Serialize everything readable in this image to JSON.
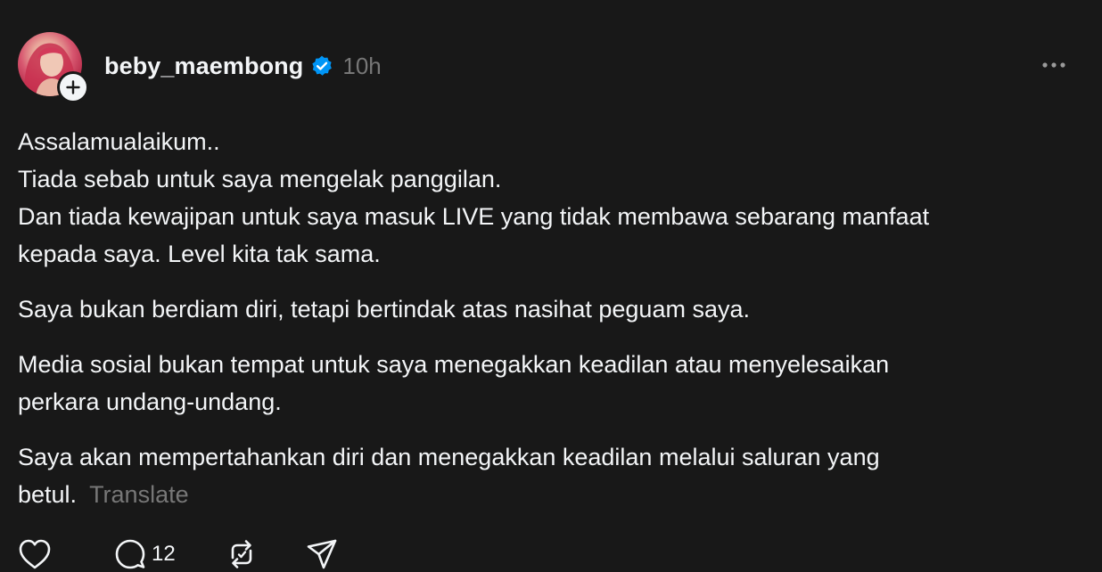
{
  "post": {
    "username": "beby_maembong",
    "timestamp": "10h",
    "verified": true,
    "paragraphs": [
      [
        "Assalamualaikum..",
        "Tiada sebab untuk saya mengelak panggilan.",
        "Dan tiada kewajipan untuk saya masuk LIVE yang tidak membawa sebarang manfaat",
        "kepada saya. Level kita tak sama."
      ],
      [
        "Saya bukan berdiam diri, tetapi bertindak atas nasihat peguam saya."
      ],
      [
        "Media sosial bukan tempat untuk saya menegakkan keadilan atau menyelesaikan",
        "perkara undang-undang."
      ],
      [
        "Saya akan mempertahankan diri dan menegakkan keadilan melalui saluran yang",
        "betul."
      ]
    ],
    "translate_label": "Translate"
  },
  "actions": {
    "like_icon": "heart-icon",
    "reply_icon": "comment-icon",
    "reply_count": "12",
    "repost_icon": "repost-icon",
    "share_icon": "send-icon"
  },
  "icons": {
    "follow": "plus-icon",
    "verified": "verified-badge-icon",
    "more": "more-options-icon"
  },
  "colors": {
    "background": "#181818",
    "text": "#f3f5f7",
    "muted": "#777777",
    "verified": "#0095f6"
  }
}
